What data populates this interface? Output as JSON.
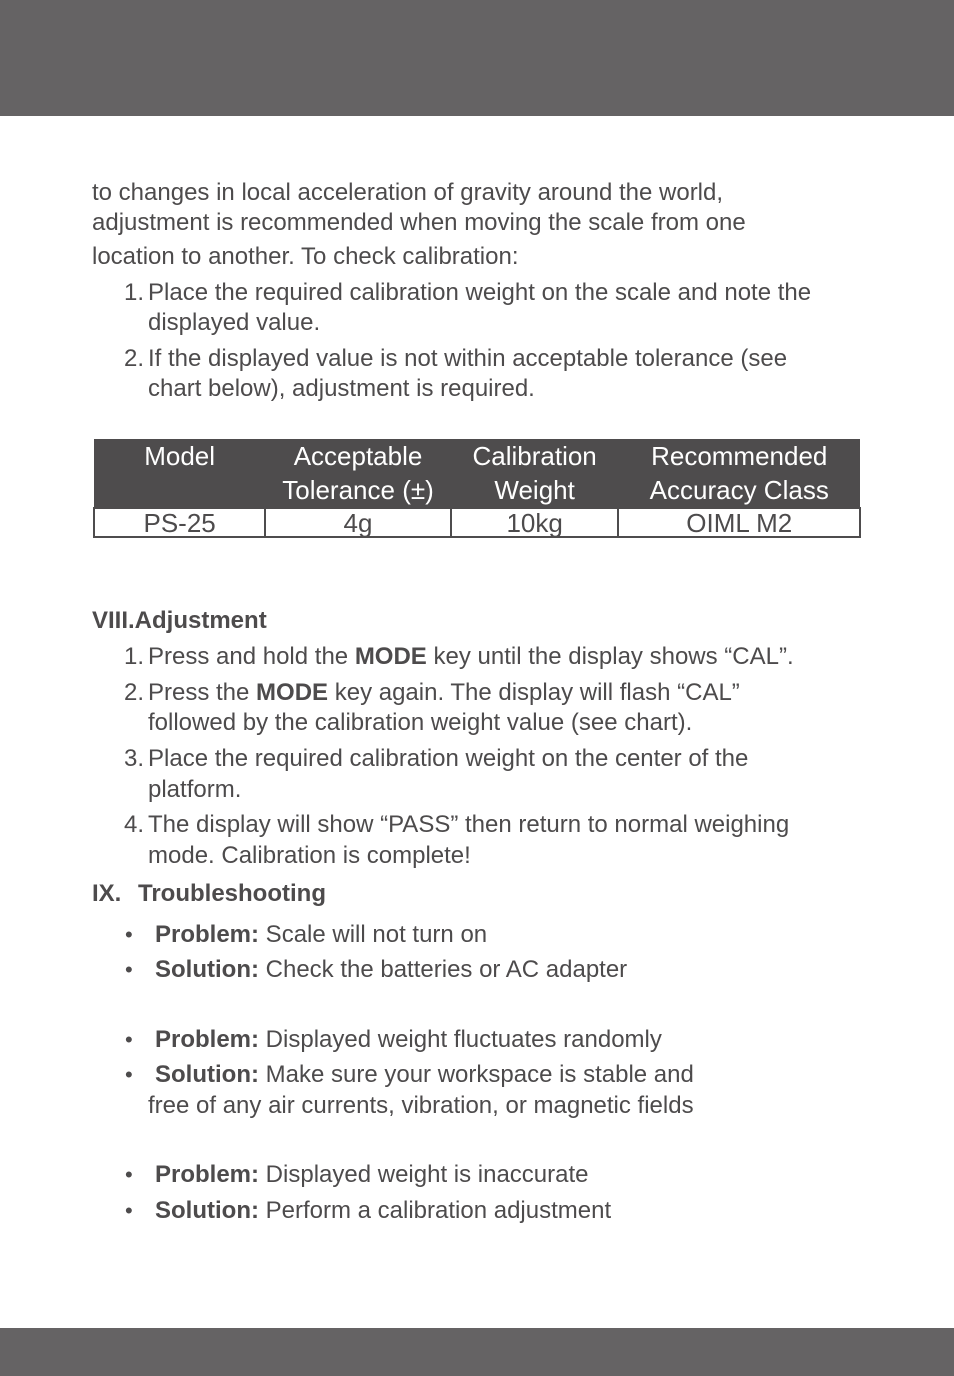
{
  "intro": {
    "lines": [
      "to changes in local acceleration of gravity around the world,",
      "adjustment is recommended when moving the scale from one",
      "location to another. To check calibration:"
    ],
    "steps": [
      {
        "num": "1.",
        "lines": [
          "Place the required calibration weight on the scale and note the",
          "displayed value."
        ]
      },
      {
        "num": "2.",
        "lines": [
          "If the displayed value is not within acceptable tolerance (see",
          "chart below), adjustment is required."
        ]
      }
    ]
  },
  "table": {
    "headers": [
      [
        "Model",
        ""
      ],
      [
        "Acceptable",
        "Tolerance (±)"
      ],
      [
        "Calibration",
        "Weight"
      ],
      [
        "Recommended",
        "Accuracy Class"
      ]
    ],
    "rows": [
      [
        "PS-25",
        "4g",
        "10kg",
        "OIML M2"
      ]
    ]
  },
  "adjustment": {
    "heading": "VIII.Adjustment",
    "steps": [
      {
        "num": "1.",
        "pre": "Press and hold the ",
        "bold": "MODE",
        "post": " key until the display shows “CAL”.",
        "line2": ""
      },
      {
        "num": "2.",
        "pre": "Press the ",
        "bold": "MODE",
        "post": " key again. The display will flash “CAL”",
        "line2": "followed by the calibration weight value (see chart)."
      },
      {
        "num": "3.",
        "pre": "Place the required calibration weight on the center of the",
        "bold": "",
        "post": "",
        "line2": "platform."
      },
      {
        "num": "4.",
        "pre": "The display will show “PASS” then return to normal weighing",
        "bold": "",
        "post": "",
        "line2": "mode. Calibration is complete!"
      }
    ]
  },
  "troubleshooting": {
    "heading_num": "IX.",
    "heading": "Troubleshooting",
    "bullet": "•",
    "problem_label": "Problem:",
    "solution_label": "Solution:",
    "items": [
      {
        "problem": " Scale will not turn on",
        "solution": " Check the batteries or AC adapter",
        "solution_line2": ""
      },
      {
        "problem": " Displayed weight fluctuates randomly",
        "solution": " Make sure your workspace is stable and",
        "solution_line2": "free of any air currents, vibration, or magnetic fields"
      },
      {
        "problem": " Displayed weight is inaccurate",
        "solution": " Perform a calibration adjustment",
        "solution_line2": ""
      }
    ]
  },
  "colors": {
    "band": "#656364",
    "table_header": "#4e4c4d",
    "text": "#4d4b4c"
  }
}
